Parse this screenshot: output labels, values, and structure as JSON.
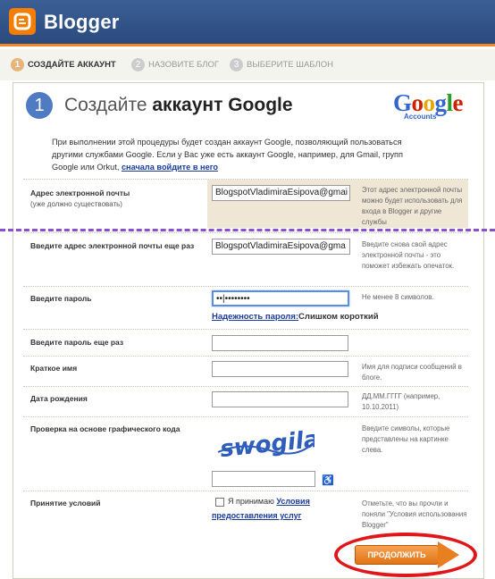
{
  "app": {
    "brand": "Blogger"
  },
  "steps": [
    {
      "num": "1",
      "label": "СОЗДАЙТЕ АККАУНТ"
    },
    {
      "num": "2",
      "label": "НАЗОВИТЕ БЛОГ"
    },
    {
      "num": "3",
      "label": "ВЫБЕРИТЕ ШАБЛОН"
    }
  ],
  "header": {
    "step_num": "1",
    "title_regular": "Создайте",
    "title_bold": "аккаунт Google"
  },
  "google_logo": {
    "letters": [
      "G",
      "o",
      "o",
      "g",
      "l",
      "e"
    ],
    "sub": "Accounts",
    "colors": [
      "#3366cc",
      "#cc2200",
      "#e8a700",
      "#3366cc",
      "#2a9c2a",
      "#cc2200"
    ]
  },
  "intro": {
    "text": "При выполнении этой процедуры будет создан аккаунт Google, позволяющий пользоваться другими службами Google. Если у Вас уже есть аккаунт Google, например, для Gmail, групп Google или Orkut,",
    "link": "сначала войдите в него"
  },
  "fields": {
    "email": {
      "label": "Адрес электронной почты",
      "sub": "(уже должно существовать)",
      "value": "BlogspotVladimiraEsipova@gmai",
      "hint": "Этот адрес электронной почты можно будет использовать для входа в Blogger и другие службы"
    },
    "email_confirm": {
      "label": "Введите адрес электронной почты еще раз",
      "value": "BlogspotVladimiraEsipova@gma",
      "hint": "Введите снова свой адрес электронной почты - это поможет избежать опечаток."
    },
    "password": {
      "label": "Введите пароль",
      "value": "••|••••••••",
      "hint": "Не менее 8 символов.",
      "strength_label": "Надежность пароля:",
      "strength_value": "Слишком короткий"
    },
    "password_confirm": {
      "label": "Введите пароль еще раз",
      "value": ""
    },
    "display_name": {
      "label": "Краткое имя",
      "value": "",
      "hint": "Имя для подписи сообщений в блоге."
    },
    "birthdate": {
      "label": "Дата рождения",
      "value": "",
      "hint": "ДД.ММ.ГГГГ (например, 10.10.2011)"
    },
    "captcha": {
      "label": "Проверка на основе графического кода",
      "image_text": "swogila",
      "value": "",
      "hint": "Введите символы, которые представлены на картинке слева."
    },
    "terms": {
      "label": "Принятие условий",
      "text": "Я принимаю",
      "link_a": "Условия",
      "link_b": "предоставления услуг",
      "hint": "Отметьте, что вы прочли и поняли \"Условия использования Blogger\""
    }
  },
  "continue": {
    "label": "ПРОДОЛЖИТЬ"
  },
  "colors": {
    "accent_orange": "#f57d00",
    "header_blue": "#2b4a7c",
    "annotation_red": "#e0171a",
    "annotation_purple": "#8a4fcf"
  }
}
